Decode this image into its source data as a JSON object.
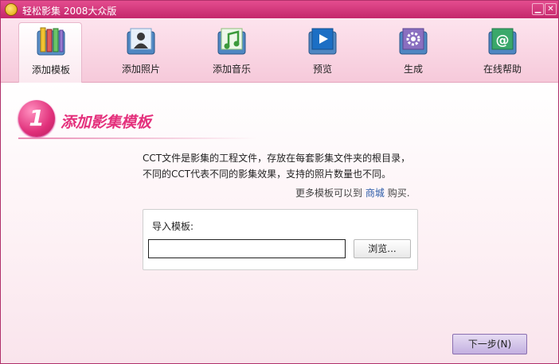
{
  "window": {
    "title": "轻松影集 2008大众版"
  },
  "titlebar": {
    "minimize_glyph": "▁",
    "close_glyph": "✕"
  },
  "toolbar": {
    "items": [
      {
        "label": "添加模板",
        "icon": "template-icon",
        "active": true
      },
      {
        "label": "添加照片",
        "icon": "photo-icon",
        "active": false
      },
      {
        "label": "添加音乐",
        "icon": "music-icon",
        "active": false
      },
      {
        "label": "预览",
        "icon": "preview-icon",
        "active": false
      },
      {
        "label": "生成",
        "icon": "generate-icon",
        "active": false
      },
      {
        "label": "在线帮助",
        "icon": "help-icon",
        "active": false
      }
    ]
  },
  "step": {
    "number": "1",
    "title": "添加影集模板"
  },
  "description": {
    "line1": "CCT文件是影集的工程文件，存放在每套影集文件夹的根目录，",
    "line2": "不同的CCT代表不同的影集效果，支持的照片数量也不同。"
  },
  "more": {
    "prefix": "更多模板可以到",
    "link": "商城",
    "suffix": "购买."
  },
  "import": {
    "label": "导入模板:",
    "value": "",
    "browse_label": "浏览..."
  },
  "footer": {
    "next_label": "下一步(N)"
  },
  "colors": {
    "title_bar": "#d63579",
    "accent": "#e4307c",
    "toolbar_bg": "#f8d3e1",
    "link": "#2a5aa8"
  }
}
